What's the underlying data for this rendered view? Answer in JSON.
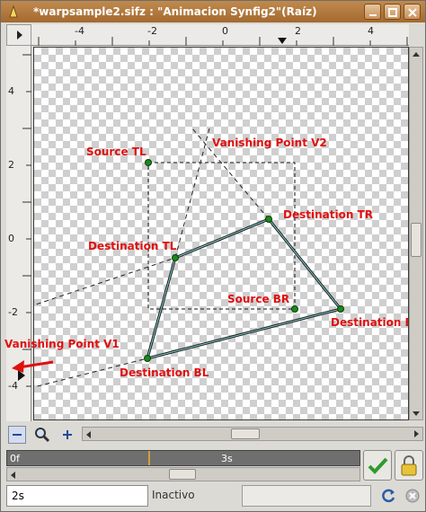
{
  "window": {
    "title": "*warpsample2.sifz : \"Animacion Synfig2\"(Raíz)"
  },
  "rulers": {
    "horizontal_ticks": [
      "-4",
      "-2",
      "0",
      "2",
      "4"
    ],
    "vertical_ticks": [
      "4",
      "2",
      "0",
      "-2",
      "-4"
    ]
  },
  "canvas": {
    "labels": {
      "source_tl": "Source TL",
      "vanishing_v2": "Vanishing Point V2",
      "dest_tr": "Destination TR",
      "dest_tl": "Destination TL",
      "source_br": "Source BR",
      "dest_br": "Destination BR",
      "vanishing_v1": "Vanishing Point V1",
      "dest_bl": "Destination BL"
    }
  },
  "timeline": {
    "start_label": "0f",
    "mid_label": "3s"
  },
  "footer": {
    "time_value": "2s",
    "status_text": "Inactivo"
  },
  "colors": {
    "handle": "#1a8a1a",
    "label": "#e01010",
    "titlebar": "#b07a3e"
  },
  "icons": {
    "zoom_out": "minus-icon",
    "zoom_fit": "magnifier-icon",
    "zoom_in": "plus-icon",
    "ok": "checkmark-icon",
    "lock": "padlock-icon",
    "refresh": "refresh-icon",
    "stop": "stop-icon"
  }
}
